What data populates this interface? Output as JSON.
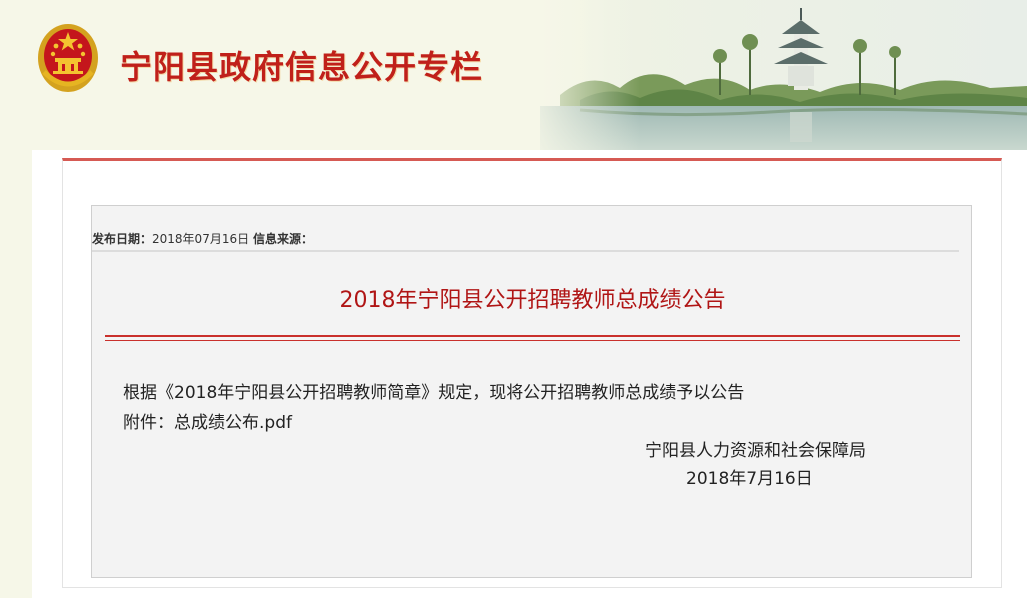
{
  "header": {
    "site_title": "宁阳县政府信息公开专栏",
    "brand_color": "#c0201a"
  },
  "article": {
    "meta_date_label": "发布日期：",
    "meta_date_value": "2018年07月16日",
    "meta_source_label": "信息来源：",
    "title": "2018年宁阳县公开招聘教师总成绩公告",
    "title_color": "#b01515",
    "body_line": "根据《2018年宁阳县公开招聘教师简章》规定，现将公开招聘教师总成绩予以公告",
    "attachment_label": "附件：",
    "attachment_link": "总成绩公布.pdf",
    "signature_org": "宁阳县人力资源和社会保障局",
    "signature_date": "2018年7月16日"
  },
  "icons": {
    "emblem": "national-emblem-icon"
  }
}
